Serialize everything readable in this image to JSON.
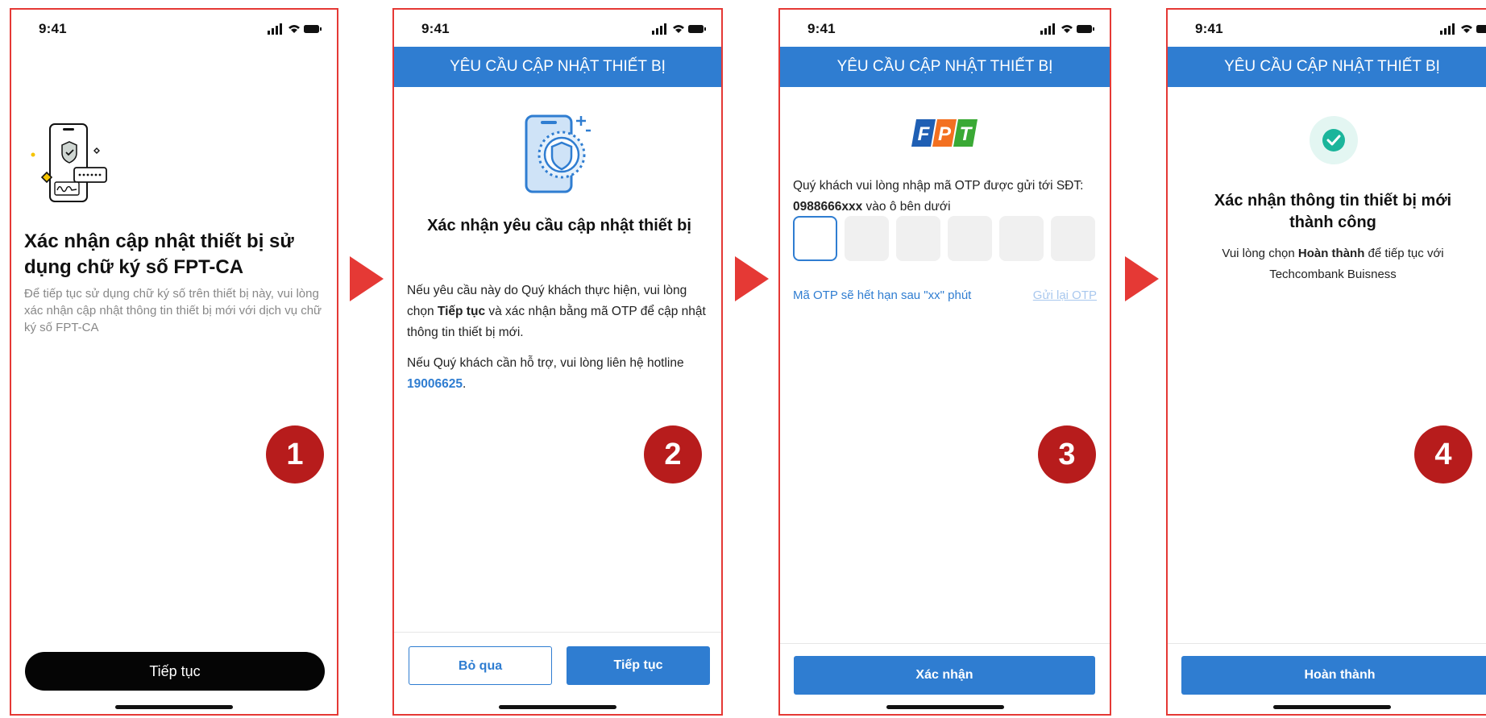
{
  "status_time": "9:41",
  "screens": [
    {
      "title": "Xác nhận cập nhật thiết bị sử dụng chữ ký số FPT-CA",
      "description": "Để tiếp tục sử dụng chữ ký số trên thiết bị này, vui lòng xác nhận cập nhật thông tin thiết bị mới với dịch vụ chữ ký số FPT-CA",
      "primary_button": "Tiếp tục",
      "step": "1"
    },
    {
      "header": "YÊU CẦU CẬP NHẬT THIẾT BỊ",
      "title": "Xác nhận yêu cầu cập nhật thiết bị",
      "para1_before": "Nếu yêu cầu này do Quý khách thực hiện, vui lòng chọn ",
      "para1_bold": "Tiếp tục",
      "para1_after": " và xác nhận bằng mã OTP để cập nhật thông tin thiết bị mới.",
      "para2_before": "Nếu Quý khách cần hỗ trợ, vui lòng liên hệ hotline ",
      "hotline": "19006625",
      "para2_after": ".",
      "secondary_button": "Bỏ qua",
      "primary_button": "Tiếp tục",
      "step": "2"
    },
    {
      "header": "YÊU CẦU CẬP NHẬT THIẾT BỊ",
      "logo_letters": [
        "F",
        "P",
        "T"
      ],
      "message_before": "Quý khách vui lòng nhập mã OTP được gửi tới SĐT:",
      "phone_number": "0988666xxx",
      "message_after": " vào ô bên dưới",
      "otp_boxes": 6,
      "expiry_text": "Mã OTP sẽ hết hạn sau \"xx\" phút",
      "resend_link": "Gửi lại OTP",
      "primary_button": "Xác nhận",
      "step": "3"
    },
    {
      "header": "YÊU CẦU CẬP NHẬT THIẾT BỊ",
      "title": "Xác nhận thông tin thiết bị mới thành công",
      "desc_before": "Vui lòng chọn ",
      "desc_bold": "Hoàn thành",
      "desc_after": " để tiếp tục với Techcombank Buisness",
      "primary_button": "Hoàn thành",
      "step": "4"
    }
  ],
  "colors": {
    "primary_blue": "#2f7dd1",
    "frame_red": "#e53935",
    "badge_red": "#b71c1c",
    "success_green": "#1bb59b"
  }
}
